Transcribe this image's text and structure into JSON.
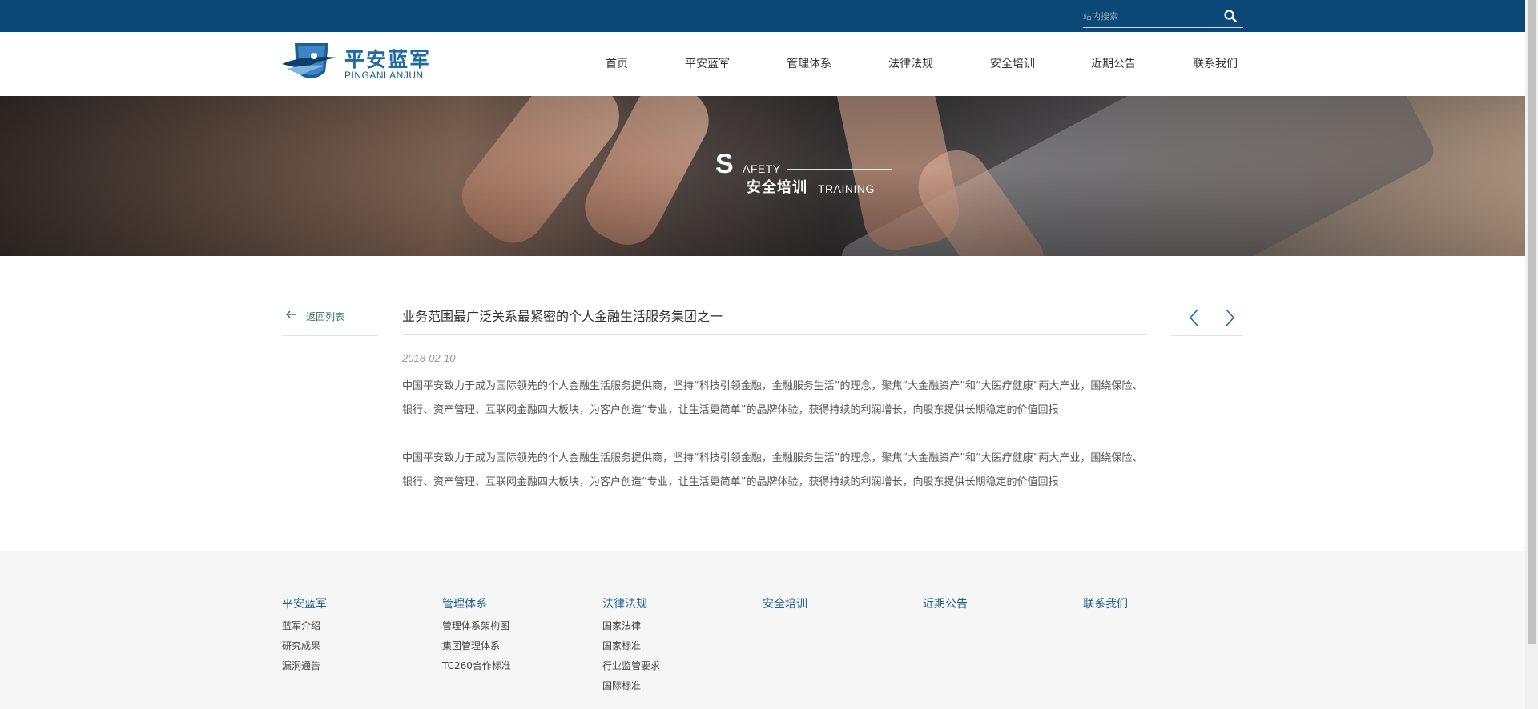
{
  "search": {
    "placeholder": "站内搜索",
    "icon": "search-icon"
  },
  "logo": {
    "cn": "平安蓝军",
    "en": "PINGANLANJUN"
  },
  "nav": [
    "首页",
    "平安蓝军",
    "管理体系",
    "法律法规",
    "安全培训",
    "近期公告",
    "联系我们"
  ],
  "banner": {
    "s": "S",
    "afety": "AFETY",
    "cn": "安全培训",
    "training": "TRAINING"
  },
  "back": {
    "icon": "arrow-left-icon",
    "label": "返回列表"
  },
  "article": {
    "title": "业务范围最广泛关系最紧密的个人金融生活服务集团之一",
    "date": "2018-02-10",
    "paragraphs": [
      "中国平安致力于成为国际领先的个人金融生活服务提供商，坚持“科技引领金融，金融服务生活”的理念，聚焦“大金融资产”和“大医疗健康”两大产业，围绕保险、银行、资产管理、互联网金融四大板块，为客户创造“专业，让生活更简单”的品牌体验，获得持续的利润增长，向股东提供长期稳定的价值回报",
      "中国平安致力于成为国际领先的个人金融生活服务提供商，坚持“科技引领金融，金融服务生活”的理念，聚焦“大金融资产”和“大医疗健康”两大产业，围绕保险、银行、资产管理、互联网金融四大板块，为客户创造“专业，让生活更简单”的品牌体验，获得持续的利润增长，向股东提供长期稳定的价值回报"
    ]
  },
  "pager": {
    "prev_icon": "chevron-left-icon",
    "next_icon": "chevron-right-icon"
  },
  "footer": [
    {
      "title": "平安蓝军",
      "links": [
        "蓝军介绍",
        "研究成果",
        "漏洞通告"
      ]
    },
    {
      "title": "管理体系",
      "links": [
        "管理体系架构图",
        "集团管理体系",
        "TC260合作标准"
      ]
    },
    {
      "title": "法律法规",
      "links": [
        "国家法律",
        "国家标准",
        "行业监管要求",
        "国际标准"
      ]
    },
    {
      "title": "安全培训",
      "links": []
    },
    {
      "title": "近期公告",
      "links": []
    },
    {
      "title": "联系我们",
      "links": []
    }
  ],
  "colors": {
    "topbar": "#0b4878",
    "accent": "#1d6aa5",
    "footer_head": "#1d5f95"
  }
}
